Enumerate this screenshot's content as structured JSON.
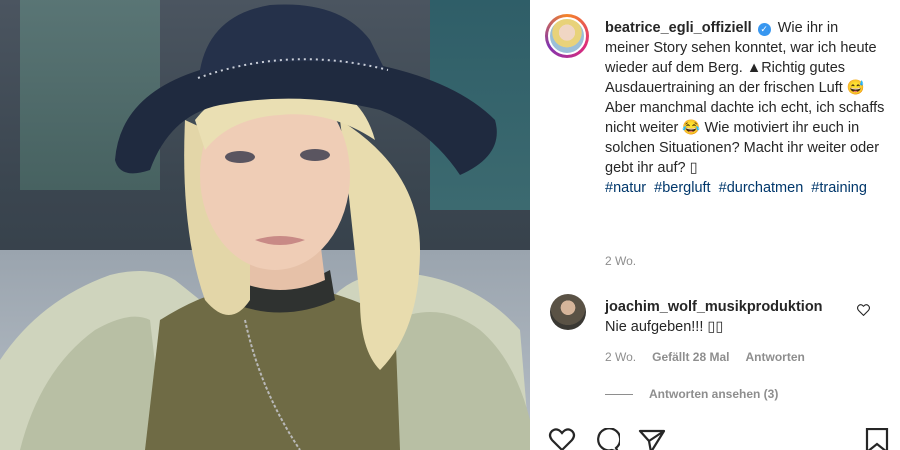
{
  "post": {
    "owner": "beatrice_egli_offiziell",
    "caption": "Wie ihr in meiner Story sehen konntet, war ich heute wieder auf dem Berg. ▲Richtig gutes Ausdauertraining an der frischen Luft 😅 Aber manchmal dachte ich echt, ich schaffs nicht weiter 😂 Wie motiviert ihr euch in solchen Situationen? Macht ihr weiter oder gebt ihr auf? ▯",
    "hashtags": [
      "#natur",
      "#bergluft",
      "#durchatmen",
      "#training"
    ],
    "time": "2 Wo."
  },
  "comment": {
    "user": "joachim_wolf_musikproduktion",
    "text": "Nie aufgeben!!! ▯▯",
    "time": "2 Wo.",
    "likes": "Gefällt 28 Mal",
    "reply_label": "Antworten",
    "view_replies": "Antworten ansehen (3)"
  },
  "icons": {
    "verified": "verified-badge-icon",
    "heart": "heart-icon",
    "comment": "comment-icon",
    "share": "share-icon",
    "save": "bookmark-icon"
  },
  "colors": {
    "link": "#00376b",
    "verified": "#3897f0",
    "muted": "#8e8e8e"
  }
}
